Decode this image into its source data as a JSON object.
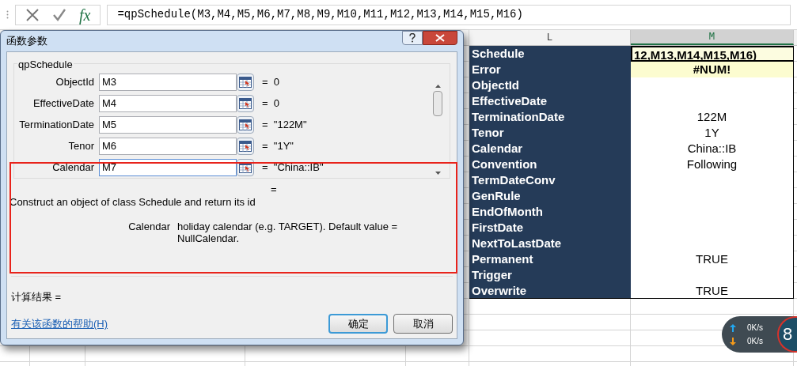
{
  "formula_bar": {
    "fx": "fx",
    "formula": "=qpSchedule(M3,M4,M5,M6,M7,M8,M9,M10,M11,M12,M13,M14,M15,M16)"
  },
  "dialog": {
    "title": "函数参数",
    "function_name": "qpSchedule",
    "arguments": [
      {
        "label": "ObjectId",
        "value": "M3",
        "result": "=  0",
        "highlighted": false
      },
      {
        "label": "EffectiveDate",
        "value": "M4",
        "result": "=  0",
        "highlighted": false
      },
      {
        "label": "TerminationDate",
        "value": "M5",
        "result": "=  \"122M\"",
        "highlighted": false
      },
      {
        "label": "Tenor",
        "value": "M6",
        "result": "=  \"1Y\"",
        "highlighted": false
      },
      {
        "label": "Calendar",
        "value": "M7",
        "result": "=  \"China::IB\"",
        "highlighted": true
      }
    ],
    "equals": "=",
    "description": "Construct an object of class Schedule and return its id",
    "param_name": "Calendar",
    "param_help": "holiday calendar (e.g. TARGET). Default value = NullCalendar.",
    "result_label": "计算结果 =",
    "help_link": "有关该函数的帮助(H)",
    "buttons": [
      {
        "label": "确定",
        "default": true
      },
      {
        "label": "取消",
        "default": false
      }
    ]
  },
  "sheet": {
    "columns": [
      {
        "label": "L",
        "selected": false
      },
      {
        "label": "M",
        "selected": true
      }
    ],
    "rows": [
      {
        "label": "Schedule",
        "value": "12,M13,M14,M15,M16)",
        "kind": "active"
      },
      {
        "label": "Error",
        "value": "#NUM!",
        "kind": "error"
      },
      {
        "label": "ObjectId",
        "kind": "normal"
      },
      {
        "label": "EffectiveDate",
        "kind": "normal"
      },
      {
        "label": "TerminationDate",
        "value": "122M",
        "kind": "normal"
      },
      {
        "label": "Tenor",
        "value": "1Y",
        "kind": "normal"
      },
      {
        "label": "Calendar",
        "value": "China::IB",
        "kind": "normal"
      },
      {
        "label": "Convention",
        "value": "Following",
        "kind": "normal"
      },
      {
        "label": "TermDateConv",
        "kind": "normal"
      },
      {
        "label": "GenRule",
        "kind": "normal"
      },
      {
        "label": "EndOfMonth",
        "kind": "normal"
      },
      {
        "label": "FirstDate",
        "kind": "normal"
      },
      {
        "label": "NextToLastDate",
        "kind": "normal"
      },
      {
        "label": "Permanent",
        "value": "TRUE",
        "kind": "normal"
      },
      {
        "label": "Trigger",
        "kind": "normal"
      },
      {
        "label": "Overwrite",
        "value": "TRUE",
        "kind": "normal"
      }
    ]
  },
  "network_widget": {
    "upload": "0K/s",
    "download": "0K/s",
    "badge": "8"
  }
}
